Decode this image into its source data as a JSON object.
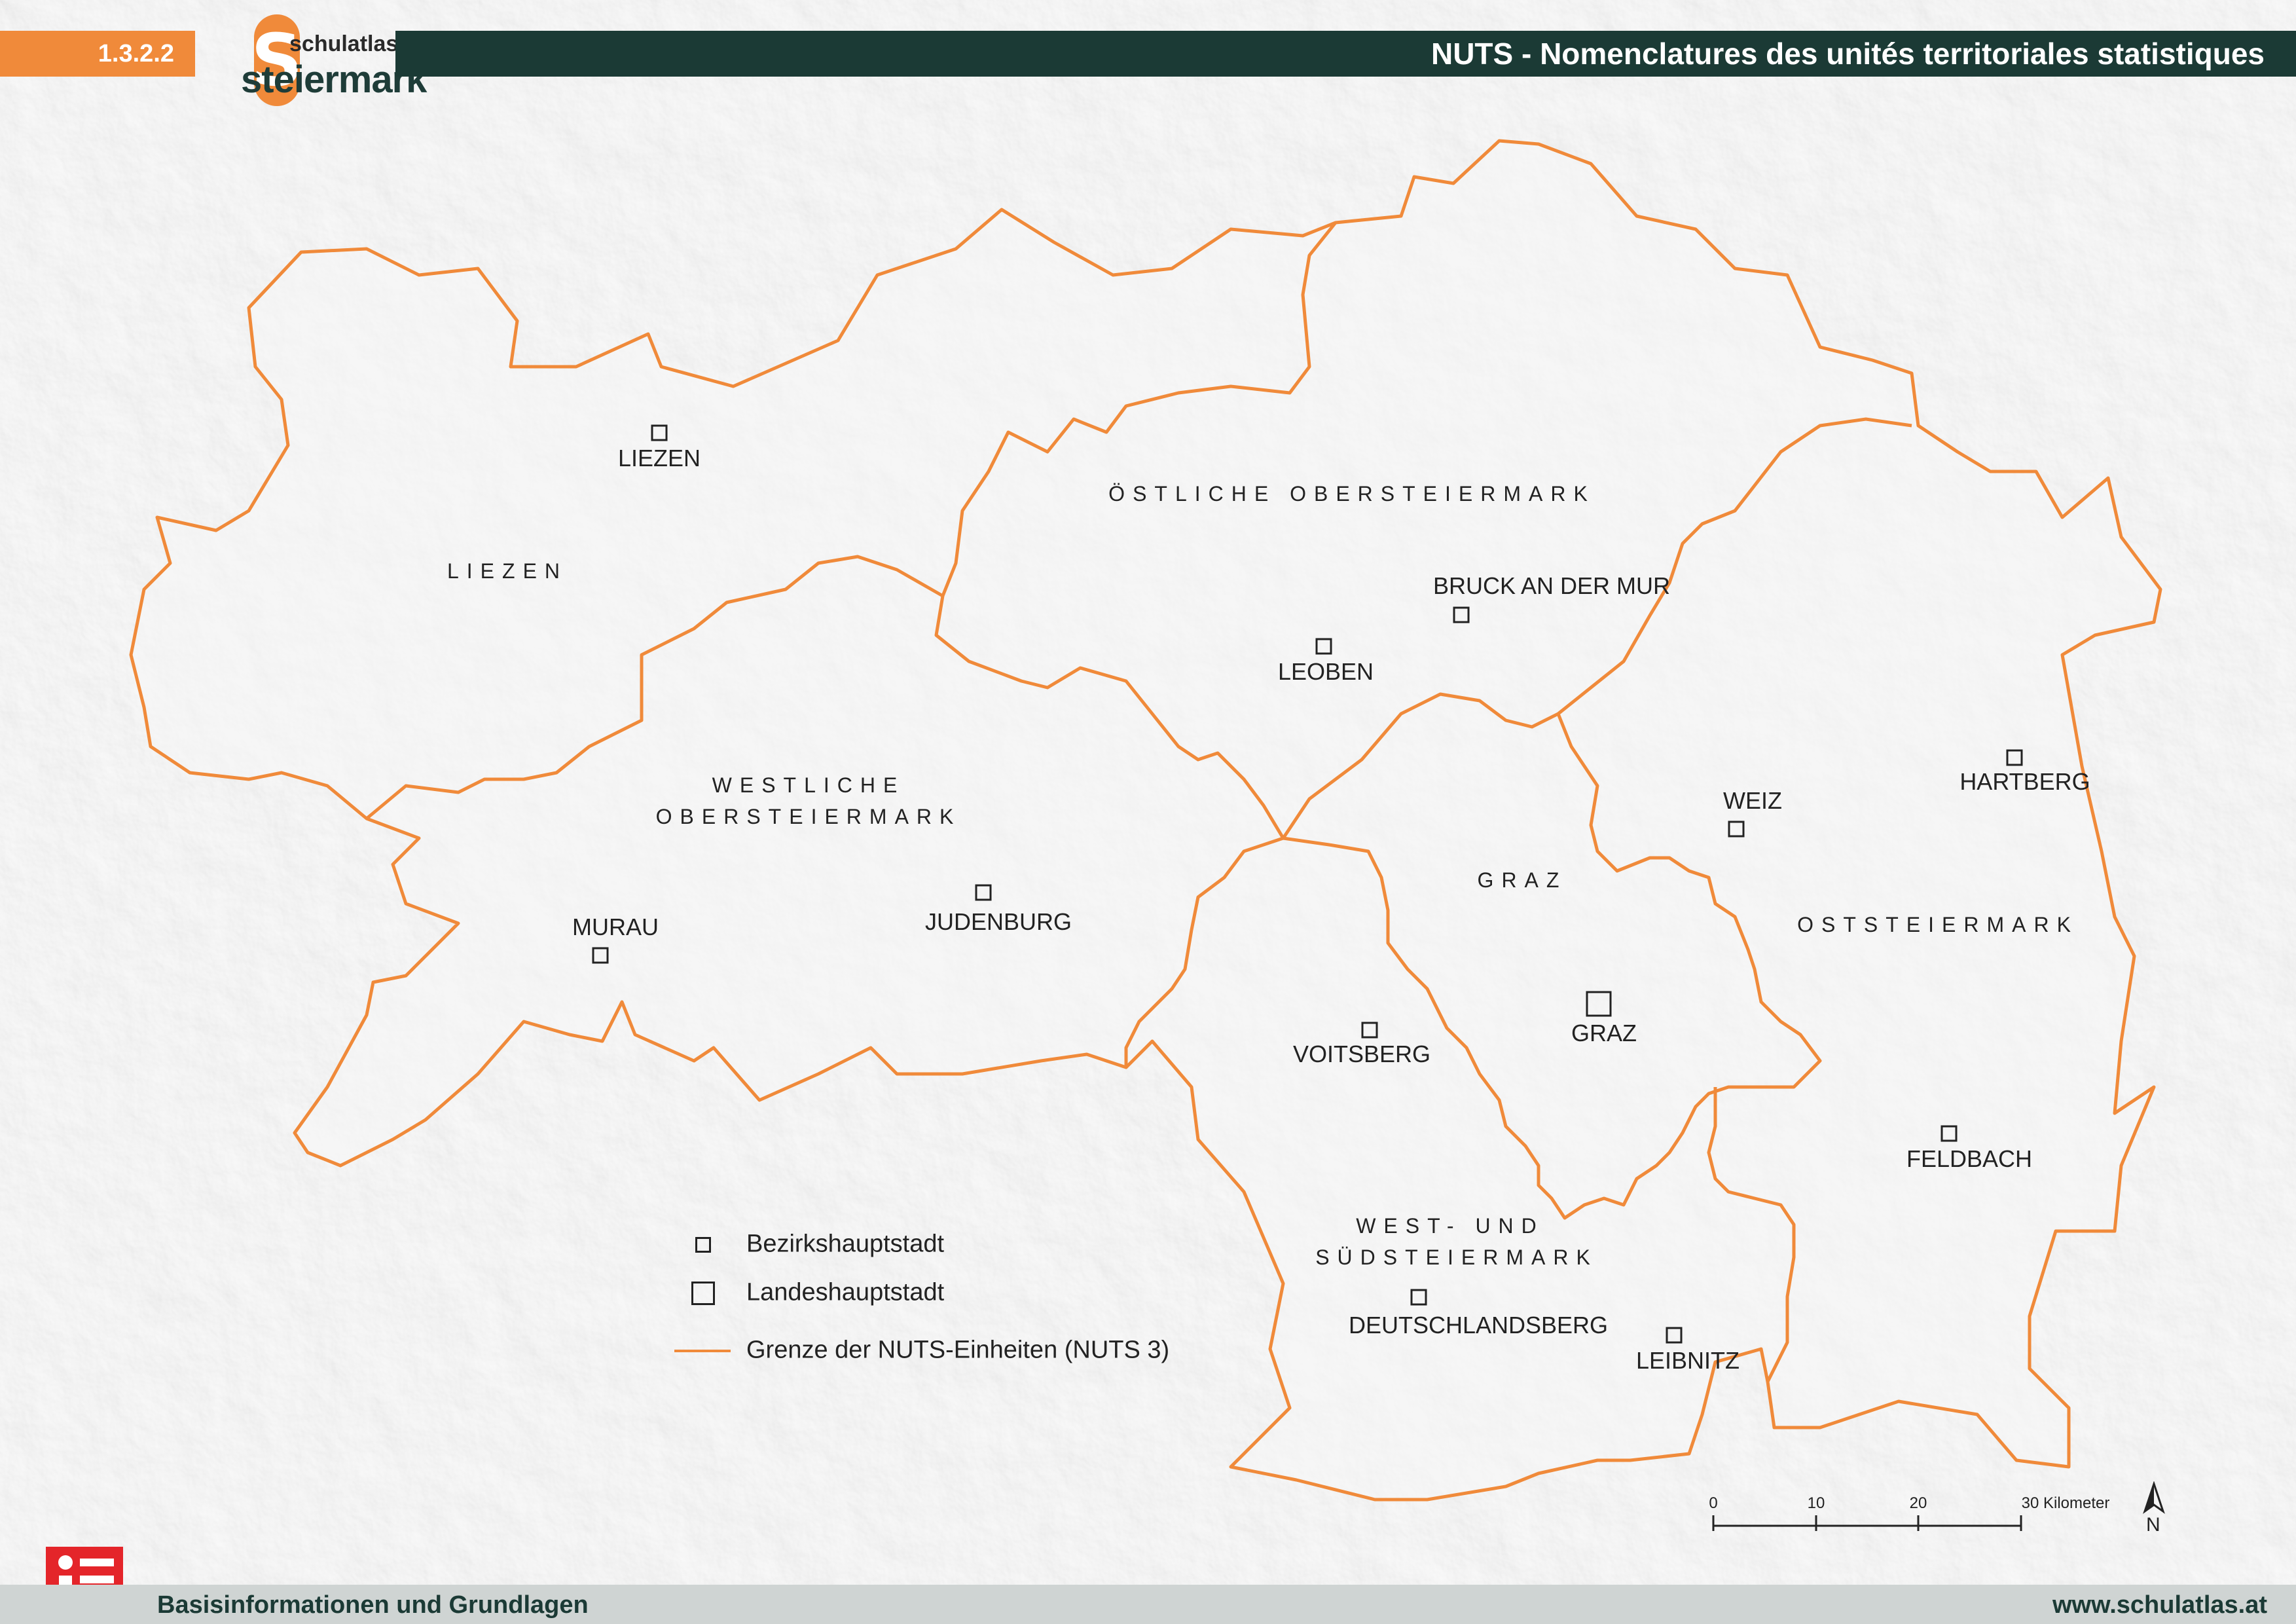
{
  "header": {
    "code": "1.3.2.2",
    "logo_top": "schulatlas",
    "logo_main": "steiermark",
    "logo_letter": "S",
    "title": "NUTS - Nomenclatures des unités territoriales statistiques"
  },
  "footer": {
    "left": "Basisinformationen und Grundlagen",
    "right": "www.schulatlas.at"
  },
  "regions": [
    {
      "name": "LIEZEN"
    },
    {
      "name": "ÖSTLICHE OBERSTEIERMARK"
    },
    {
      "name": "WESTLICHE"
    },
    {
      "name": "OBERSTEIERMARK"
    },
    {
      "name": "GRAZ"
    },
    {
      "name": "OSTSTEIERMARK"
    },
    {
      "name": "WEST- UND"
    },
    {
      "name": "SÜDSTEIERMARK"
    }
  ],
  "cities": [
    {
      "name": "LIEZEN",
      "type": "district"
    },
    {
      "name": "BRUCK AN DER MUR",
      "type": "district"
    },
    {
      "name": "LEOBEN",
      "type": "district"
    },
    {
      "name": "WEIZ",
      "type": "district"
    },
    {
      "name": "HARTBERG",
      "type": "district"
    },
    {
      "name": "MURAU",
      "type": "district"
    },
    {
      "name": "JUDENBURG",
      "type": "district"
    },
    {
      "name": "VOITSBERG",
      "type": "district"
    },
    {
      "name": "GRAZ",
      "type": "capital"
    },
    {
      "name": "FELDBACH",
      "type": "district"
    },
    {
      "name": "DEUTSCHLANDSBERG",
      "type": "district"
    },
    {
      "name": "LEIBNITZ",
      "type": "district"
    }
  ],
  "legend": {
    "district": "Bezirkshauptstadt",
    "capital": "Landeshauptstadt",
    "border": "Grenze der NUTS-Einheiten (NUTS 3)"
  },
  "scale": {
    "ticks": [
      "0",
      "10",
      "20",
      "30 Kilometer"
    ]
  },
  "north_label": "N",
  "colors": {
    "border": "#f08a3a",
    "header_dark": "#1b3a35",
    "header_accent": "#f08a3a",
    "info_icon": "#e4252a"
  }
}
